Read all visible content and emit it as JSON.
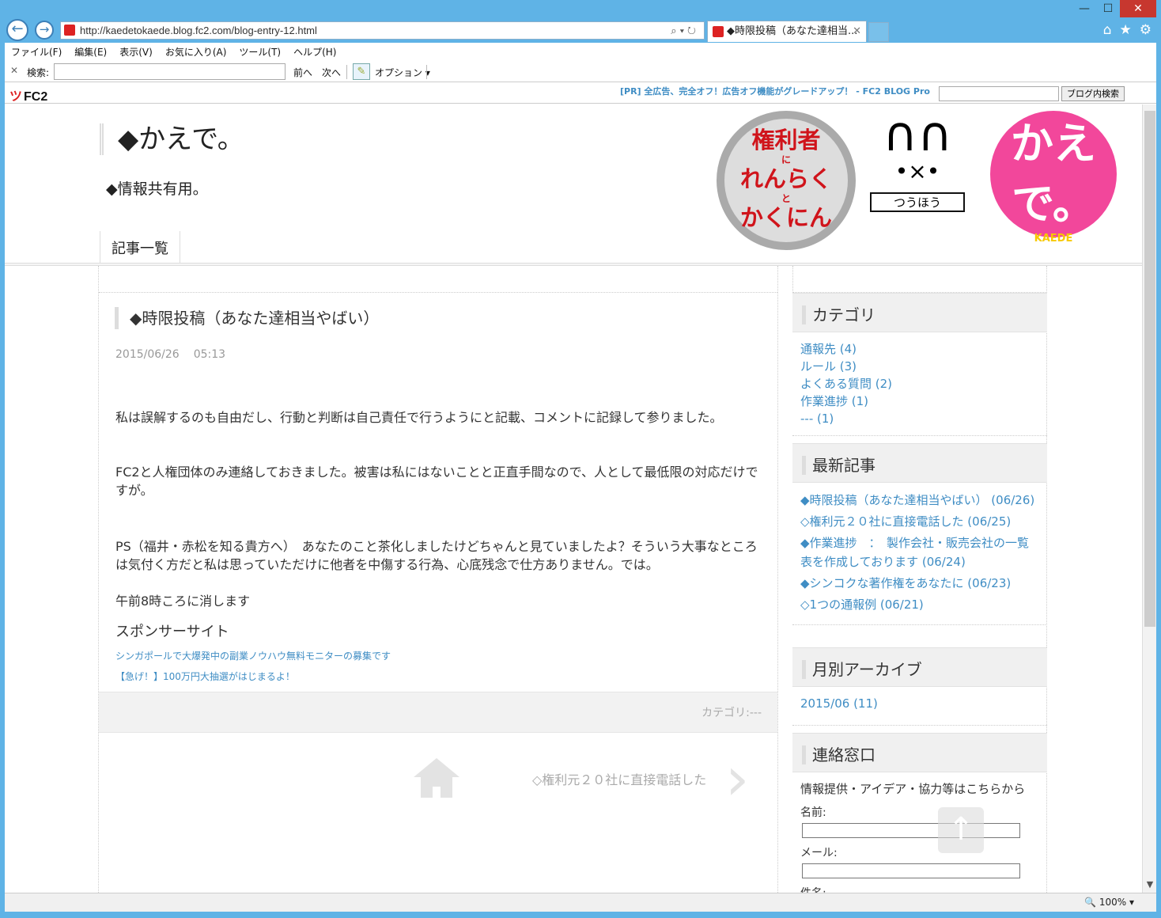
{
  "browser": {
    "address": "http://kaedetokaede.blog.fc2.com/blog-entry-12.html",
    "tab_title": "◆時限投稿（あなた達相当...",
    "menu": [
      "ファイル(F)",
      "編集(E)",
      "表示(V)",
      "お気に入り(A)",
      "ツール(T)",
      "ヘルプ(H)"
    ],
    "search_label": "検索:",
    "prev": "前へ",
    "next": "次へ",
    "options": "オプション",
    "zoom": "100%"
  },
  "fc2bar": {
    "logo": "FC2",
    "pr_text": "[PR] 全広告、完全オフ！広告オフ機能がグレードアップ！ - FC2 BLOG Pro",
    "search_button": "ブログ内検索"
  },
  "site": {
    "title": "◆かえで。",
    "description": "◆情報共有用。",
    "nav_item": "記事一覧",
    "header_images": {
      "badge_text": [
        "権利者",
        "に",
        "れんらく",
        "と",
        "かくにん"
      ],
      "bunny_text": "つうほう",
      "kaede_text": "かえで。",
      "kaede_en": "KAEDE"
    }
  },
  "post": {
    "title": "◆時限投稿（あなた達相当やばい）",
    "date": "2015/06/26",
    "time": "05:13",
    "paragraphs": [
      "私は誤解するのも自由だし、行動と判断は自己責任で行うようにと記載、コメントに記録して参りました。",
      "FC2と人権団体のみ連絡しておきました。被害は私にはないことと正直手間なので、人として最低限の対応だけですが。",
      "PS（福井・赤松を知る貴方へ）　あなたのこと茶化しましたけどちゃんと見ていましたよ？そういう大事なところは気付く方だと私は思っていただけに他者を中傷する行為、心底残念で仕方ありません。では。",
      "午前8時ころに消します"
    ],
    "sponsor_heading": "スポンサーサイト",
    "sponsor_links": [
      "シンガポールで大爆発中の副業ノウハウ無料モニターの募集です",
      "【急げ！】100万円大抽選がはじまるよ！"
    ],
    "category_footer": "カテゴリ:---",
    "next_entry": "◇権利元２０社に直接電話した"
  },
  "sidebar": {
    "categories": {
      "heading": "カテゴリ",
      "items": [
        "通報先 (4)",
        "ルール (3)",
        "よくある質問 (2)",
        "作業進捗 (1)",
        "--- (1)"
      ]
    },
    "recent": {
      "heading": "最新記事",
      "items": [
        "◆時限投稿（あなた達相当やばい） (06/26)",
        "◇権利元２０社に直接電話した (06/25)",
        "◆作業進捗　：　製作会社・販売会社の一覧表を作成しております (06/24)",
        "◆シンコクな著作権をあなたに (06/23)",
        "◇1つの通報例 (06/21)"
      ]
    },
    "archive": {
      "heading": "月別アーカイブ",
      "items": [
        "2015/06 (11)"
      ]
    },
    "contact": {
      "heading": "連絡窓口",
      "intro": "情報提供・アイデア・協力等はこちらから",
      "name_label": "名前:",
      "mail_label": "メール:",
      "subject_label": "件名:"
    }
  },
  "colors": {
    "link": "#3f8dc4",
    "frame": "#5fb3e6",
    "kaede_pink": "#f2479b"
  }
}
